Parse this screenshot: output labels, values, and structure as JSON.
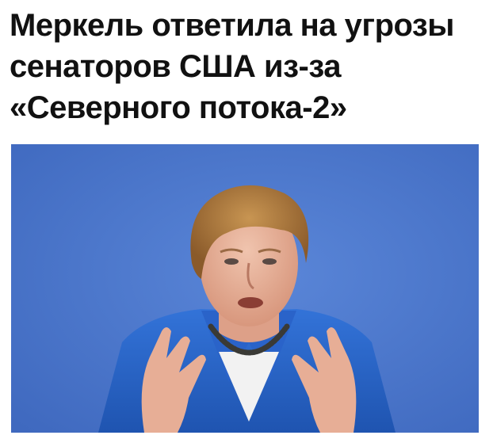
{
  "article": {
    "headline": "Меркель ответила на угрозы сенаторов США из-за «Северного потока-2»",
    "photo": {
      "subject-icon": "person-portrait-icon",
      "background_color": "#4a76cc",
      "jacket_color": "#2a63c9",
      "hair_color": "#b07c3e"
    }
  }
}
